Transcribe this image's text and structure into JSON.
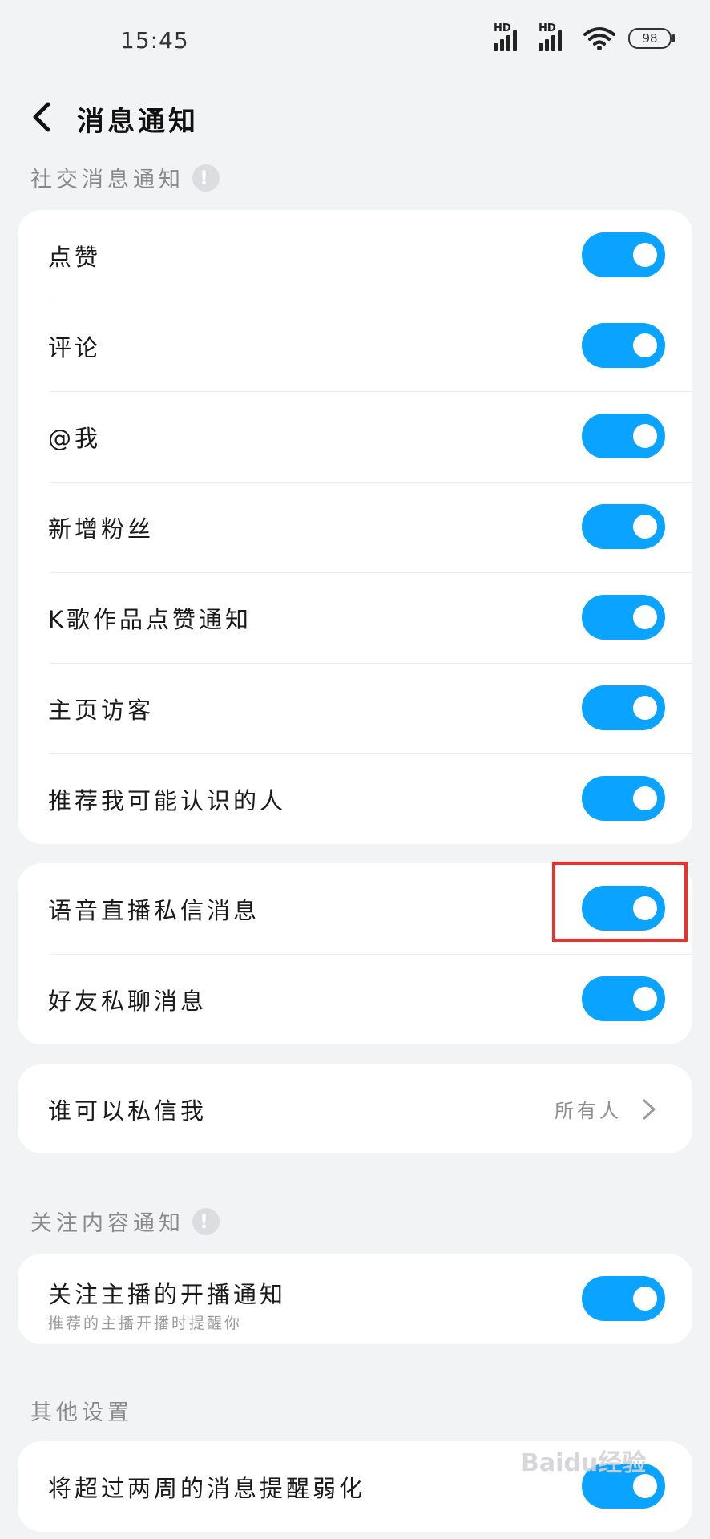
{
  "status_bar": {
    "time": "15:45",
    "signal1_label": "HD",
    "signal2_label": "HD",
    "battery": "98"
  },
  "header": {
    "title": "消息通知"
  },
  "sections": {
    "social": {
      "label": "社交消息通知",
      "info_icon": "!"
    },
    "follow": {
      "label": "关注内容通知",
      "info_icon": "!"
    },
    "other": {
      "label": "其他设置"
    }
  },
  "social_items": [
    {
      "label": "点赞",
      "on": true
    },
    {
      "label": "评论",
      "on": true
    },
    {
      "label": "@我",
      "on": true
    },
    {
      "label": "新增粉丝",
      "on": true
    },
    {
      "label": "K歌作品点赞通知",
      "on": true
    },
    {
      "label": "主页访客",
      "on": true
    },
    {
      "label": "推荐我可能认识的人",
      "on": true
    }
  ],
  "message_items": [
    {
      "label": "语音直播私信消息",
      "on": true
    },
    {
      "label": "好友私聊消息",
      "on": true
    }
  ],
  "privacy": {
    "label": "谁可以私信我",
    "value": "所有人"
  },
  "follow_items": [
    {
      "label": "关注主播的开播通知",
      "sub": "推荐的主播开播时提醒你",
      "on": true
    }
  ],
  "other_items": [
    {
      "label": "将超过两周的消息提醒弱化",
      "on": true
    }
  ],
  "watermark": "Baidu经验",
  "colors": {
    "toggle_on": "#0aa3ff",
    "highlight": "#e8322d",
    "background": "#f2f3f5"
  }
}
